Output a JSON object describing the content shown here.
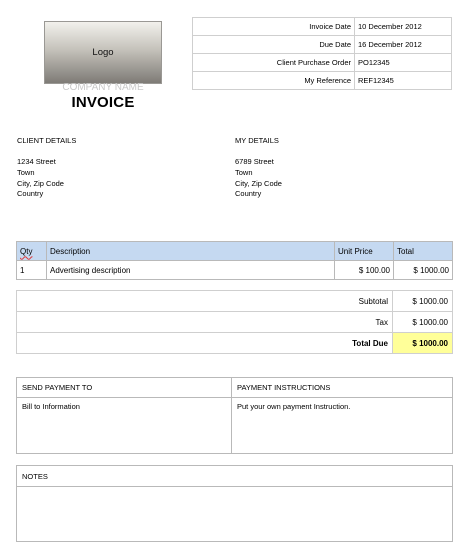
{
  "logo": {
    "label": "Logo"
  },
  "company_name": "COMPANY NAME",
  "title": "INVOICE",
  "meta": [
    {
      "key": "Invoice  Date",
      "value": "10  December  2012"
    },
    {
      "key": "Due  Date",
      "value": "16  December  2012"
    },
    {
      "key": "Client  Purchase  Order",
      "value": "PO12345"
    },
    {
      "key": "My  Reference",
      "value": "REF12345"
    }
  ],
  "client": {
    "heading": "CLIENT  DETAILS",
    "lines": [
      "1234  Street",
      "Town",
      "City, Zip Code",
      "Country"
    ]
  },
  "mine": {
    "heading": "MY  DETAILS",
    "lines": [
      "6789  Street",
      "Town",
      "City, Zip Code",
      "Country"
    ]
  },
  "items": {
    "headers": {
      "qty": "Qty",
      "description": "Description",
      "unit_price": "Unit Price",
      "total": "Total"
    },
    "rows": [
      {
        "qty": "1",
        "description": "Advertising description",
        "unit_price": "$  100.00",
        "total": "$  1000.00"
      }
    ]
  },
  "totals": {
    "subtotal_label": "Subtotal",
    "subtotal": "$  1000.00",
    "tax_label": "Tax",
    "tax": "$  1000.00",
    "due_label": "Total Due",
    "due": "$  1000.00",
    "highlight_color": "#ffff99"
  },
  "payment": {
    "send_heading": "SEND  PAYMENT  TO",
    "send_text": "Bill to Information",
    "instr_heading": "PAYMENT  INSTRUCTIONS",
    "instr_text": "Put your own  payment   Instruction."
  },
  "notes": {
    "heading": "NOTES"
  },
  "colors": {
    "header_fill": "#c5d9f1",
    "border": "#b9b9b9"
  }
}
